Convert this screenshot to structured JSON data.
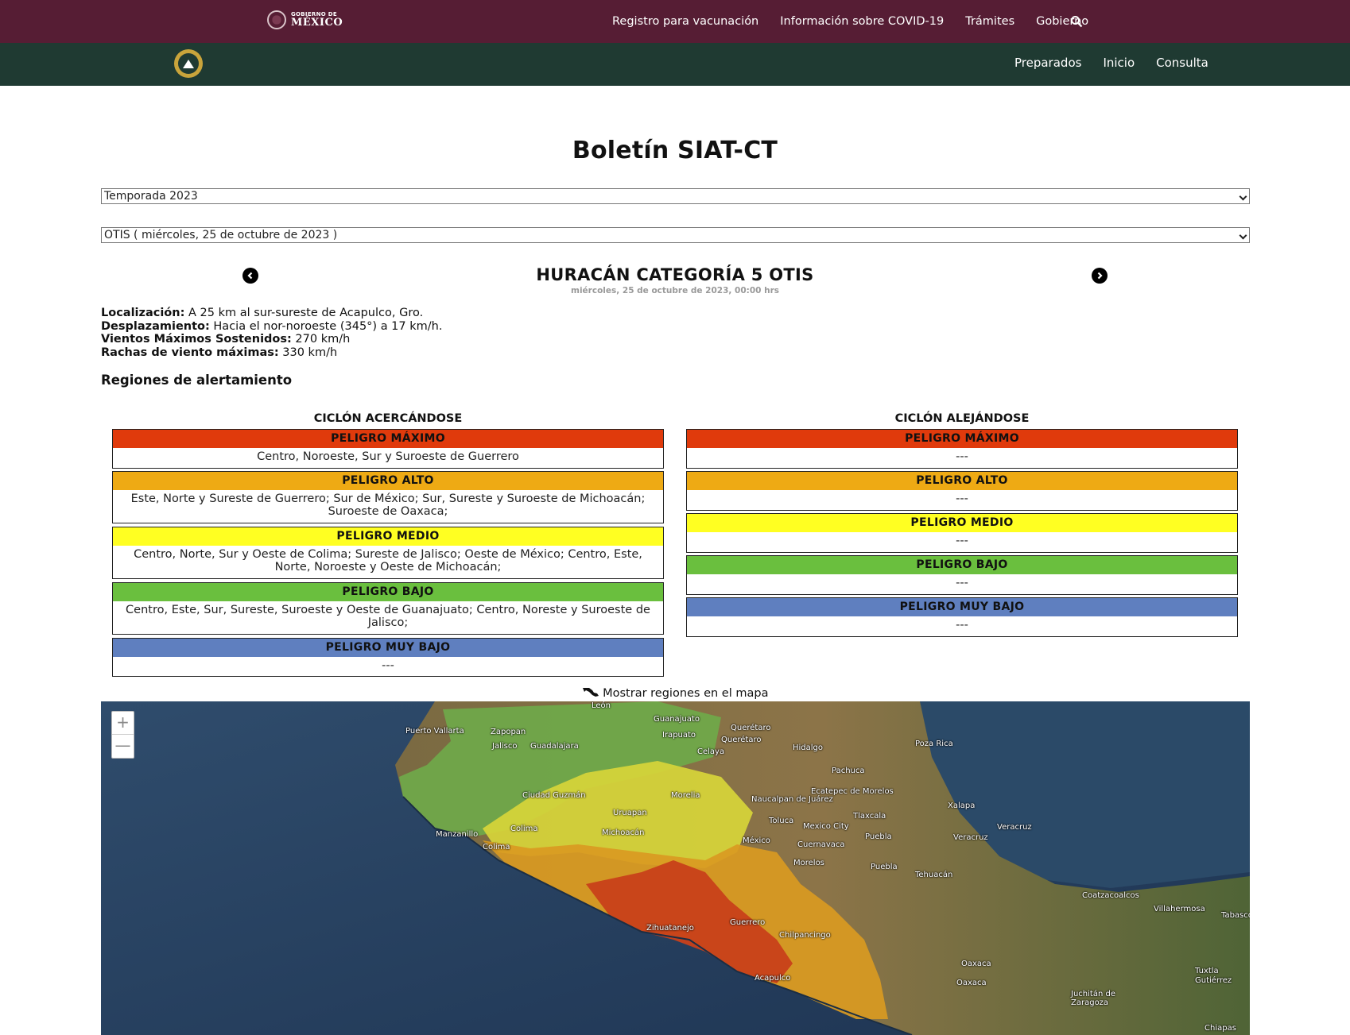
{
  "gov_bar": {
    "logo_line1": "GOBIERNO DE",
    "logo_line2": "MÉXICO",
    "nav": [
      "Registro para vacunación",
      "Información sobre COVID-19",
      "Trámites",
      "Gobierno"
    ],
    "search_icon": "search-icon",
    "bg": "#561d34"
  },
  "sec_bar": {
    "nav": [
      "Preparados",
      "Inicio",
      "Consulta"
    ],
    "bg": "#1f3a32"
  },
  "page": {
    "title": "Boletín SIAT-CT",
    "season_select": "Temporada 2023",
    "storm_select": "OTIS ( miércoles, 25 de octubre de 2023 )"
  },
  "storm": {
    "title": "HURACÁN CATEGORÍA 5 OTIS",
    "date": "miércoles, 25 de octubre de 2023, 00:00 hrs",
    "prev_icon": "chevron-left-circle-icon",
    "next_icon": "chevron-right-circle-icon"
  },
  "info": {
    "loc_label": "Localización:",
    "loc_value": " A 25 km al sur-sureste de Acapulco, Gro.",
    "move_label": "Desplazamiento:",
    "move_value": " Hacia el nor-noroeste (345°) a 17 km/h.",
    "wind_label": "Vientos Máximos Sostenidos:",
    "wind_value": " 270 km/h",
    "gust_label": "Rachas de viento máximas:",
    "gust_value": " 330 km/h"
  },
  "regions_title": "Regiones de alertamiento",
  "approaching": {
    "heading": "CICLÓN ACERCÁNDOSE",
    "levels": [
      {
        "label": "PELIGRO MÁXIMO",
        "text": "Centro, Noroeste, Sur y Suroeste de Guerrero",
        "color": "#e03a0c"
      },
      {
        "label": "PELIGRO ALTO",
        "text": "Este, Norte y Sureste de Guerrero; Sur de México; Sur, Sureste y Suroeste de Michoacán; Suroeste de Oaxaca;",
        "color": "#eeaa14"
      },
      {
        "label": "PELIGRO MEDIO",
        "text": "Centro, Norte, Sur y Oeste de Colima; Sureste de Jalisco; Oeste de México; Centro, Este, Norte, Noroeste y Oeste de Michoacán;",
        "color": "#ffff22"
      },
      {
        "label": "PELIGRO BAJO",
        "text": "Centro, Este, Sur, Sureste, Suroeste y Oeste de Guanajuato; Centro, Noreste y Suroeste de Jalisco;",
        "color": "#6abf3e"
      },
      {
        "label": "PELIGRO MUY BAJO",
        "text": "---",
        "color": "#5f7fbf"
      }
    ]
  },
  "receding": {
    "heading": "CICLÓN ALEJÁNDOSE",
    "levels": [
      {
        "label": "PELIGRO MÁXIMO",
        "text": "---",
        "color": "#e03a0c"
      },
      {
        "label": "PELIGRO ALTO",
        "text": "---",
        "color": "#eeaa14"
      },
      {
        "label": "PELIGRO MEDIO",
        "text": "---",
        "color": "#ffff22"
      },
      {
        "label": "PELIGRO BAJO",
        "text": "---",
        "color": "#6abf3e"
      },
      {
        "label": "PELIGRO MUY BAJO",
        "text": "---",
        "color": "#5f7fbf"
      }
    ]
  },
  "map": {
    "toggle_label": "Mostrar regiones en el mapa",
    "toggle_icon": "mexico-map-icon",
    "zoom_in": "+",
    "zoom_out": "—",
    "cities": [
      "León",
      "Guanajuato",
      "Puerto Vallarta",
      "Zapopan",
      "Irapuato",
      "Querétaro",
      "Querétaro",
      "Jalisco",
      "Guadalajara",
      "Celaya",
      "Hidalgo",
      "Poza Rica",
      "Pachuca",
      "Ciudad Guzmán",
      "Morelia",
      "Naucalpan de Juárez",
      "Ecatepec de Morelos",
      "Xalapa",
      "Uruapan",
      "Tlaxcala",
      "Toluca",
      "Mexico City",
      "Veracruz",
      "Colima",
      "Manzanillo",
      "Michoacán",
      "Puebla",
      "Veracruz",
      "México",
      "Cuernavaca",
      "Colima",
      "Morelos",
      "Puebla",
      "Tehuacán",
      "Coatzacoalcos",
      "Villahermosa",
      "Tabasco",
      "Zihuatanejo",
      "Guerrero",
      "Chilpancingo",
      "Oaxaca",
      "Acapulco",
      "Oaxaca",
      "Tuxtla Gutiérrez",
      "Juchitán de Zaragoza",
      "Chiapas"
    ]
  }
}
